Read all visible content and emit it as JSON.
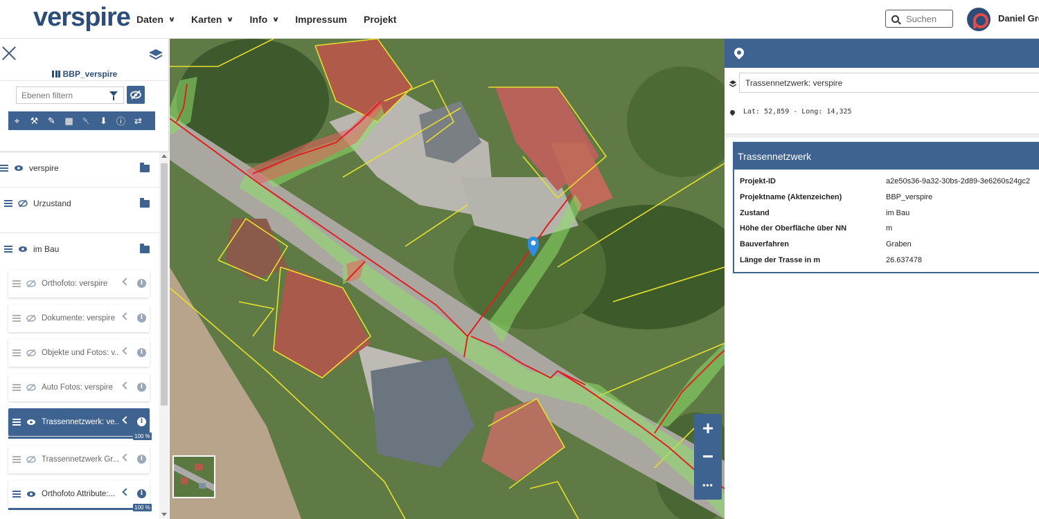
{
  "header": {
    "logo_main": "verspire",
    "nav": [
      "Daten",
      "Karten",
      "Info",
      "Impressum",
      "Projekt"
    ],
    "search_placeholder": "Suchen",
    "user_name": "Daniel Gre"
  },
  "sidebar": {
    "project_name": "BBP_verspire",
    "filter_placeholder": "Ebenen filtern",
    "toolbar_icons": [
      "zoom-extent-icon",
      "wrench-icon",
      "brush-icon",
      "table-icon",
      "trash-icon",
      "download-icon",
      "info-icon",
      "swap-icon"
    ],
    "groups": [
      {
        "label": "verspire",
        "visible": true
      },
      {
        "label": "Urzustand",
        "visible": false
      },
      {
        "label": "im Bau",
        "visible": true
      }
    ],
    "layers": [
      {
        "label": "Orthofoto: verspire",
        "visible": false
      },
      {
        "label": "Dokumente: verspire",
        "visible": false
      },
      {
        "label": "Objekte und Fotos: v...",
        "visible": false
      },
      {
        "label": "Auto Fotos: verspire",
        "visible": false
      },
      {
        "label": "Trassennetzwerk: ve...",
        "visible": true,
        "active": true,
        "opacity": "100 %"
      },
      {
        "label": "Trassennetzwerk Gr...",
        "visible": false
      },
      {
        "label": "Orthofoto Attribute:...",
        "visible": true,
        "opacity": "100 %"
      }
    ]
  },
  "map": {
    "zoom_in": "+",
    "zoom_out": "−",
    "more": "•••"
  },
  "info_panel": {
    "selected_layer": "Trassennetzwerk: verspire",
    "coordinates": "Lat: 52,859 - Long: 14,325",
    "feature_title": "Trassennetzwerk",
    "attributes": [
      {
        "key": "Projekt-ID",
        "value": "a2e50s36-9a32-30bs-2d89-3e6260s24gc2"
      },
      {
        "key": "Projektname (Aktenzeichen)",
        "value": "BBP_verspire"
      },
      {
        "key": "Zustand",
        "value": "im Bau"
      },
      {
        "key": "Höhe der Oberfläche über NN",
        "value": "m"
      },
      {
        "key": "Bauverfahren",
        "value": "Graben"
      },
      {
        "key": "Länge der Trasse in m",
        "value": "26.637478"
      }
    ]
  },
  "colors": {
    "primary": "#3f6390",
    "brand_blue": "#2c4d78",
    "brand_red": "#e54a4a",
    "route_red": "#e02020",
    "parcel_yellow": "#e8e02a",
    "buffer_green": "#8ee06a"
  }
}
